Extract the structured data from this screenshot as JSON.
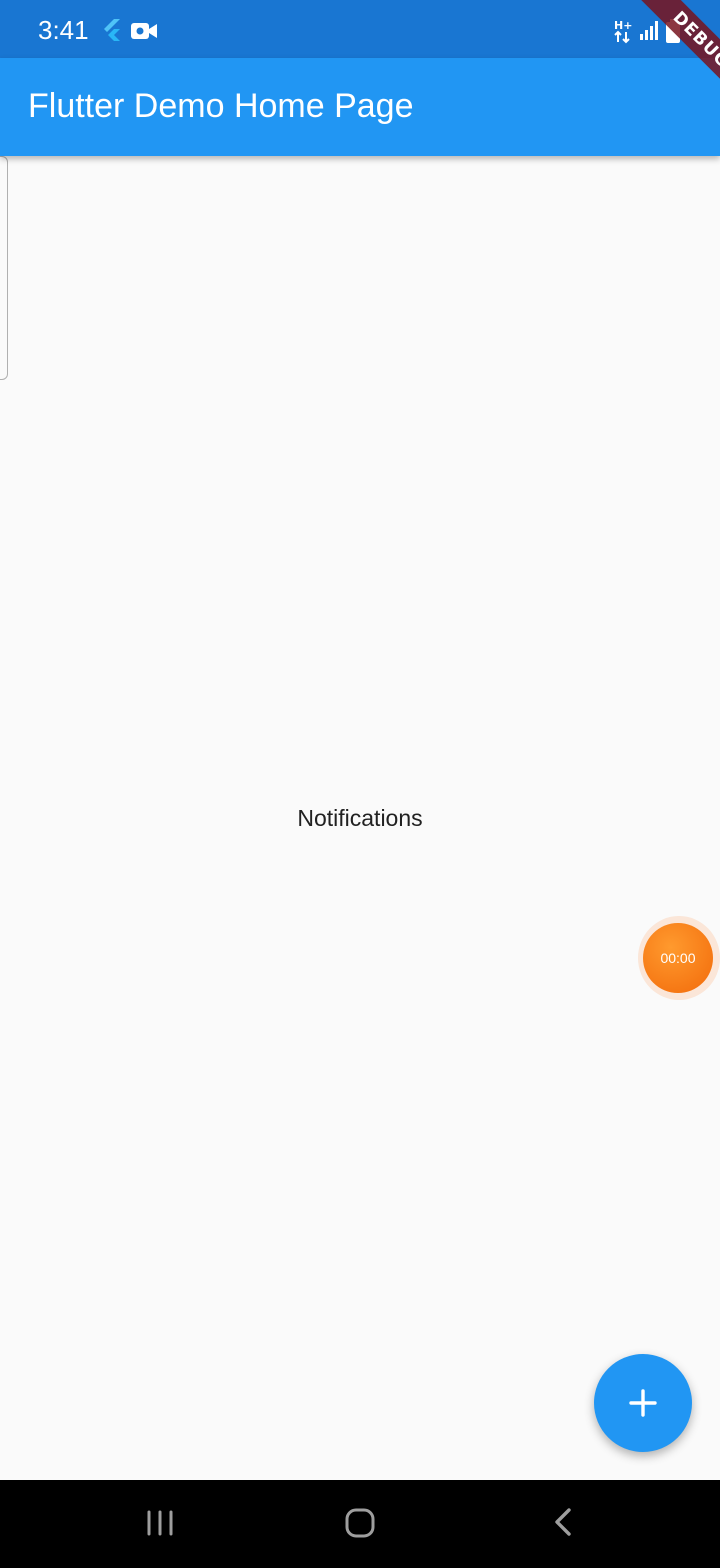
{
  "status_bar": {
    "time": "3:41",
    "icons": [
      "flutter-icon",
      "video-camera-icon",
      "mobile-data-icon",
      "signal-icon",
      "battery-icon"
    ],
    "background_color": "#1976d2"
  },
  "app_bar": {
    "title": "Flutter Demo Home Page",
    "background_color": "#2196f3"
  },
  "debug_banner": {
    "label": "DEBUG"
  },
  "body": {
    "label": "Notifications"
  },
  "timer_bubble": {
    "time": "00:00",
    "color": "#f5780f"
  },
  "fab": {
    "icon": "plus-icon",
    "color": "#2196f3"
  },
  "navigation_bar": {
    "buttons": [
      "recents-icon",
      "home-icon",
      "back-icon"
    ]
  }
}
